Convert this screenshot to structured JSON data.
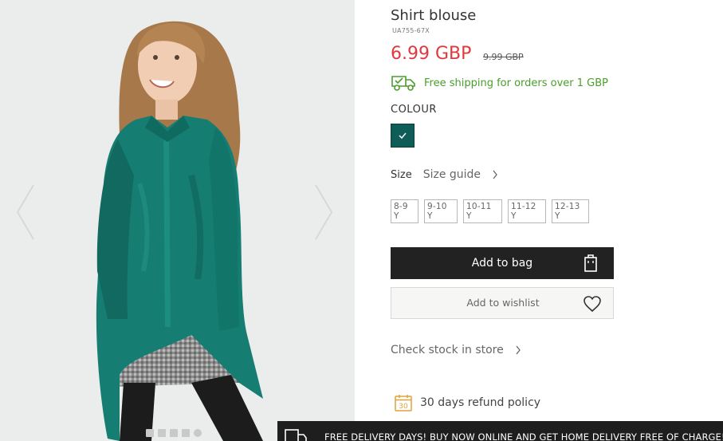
{
  "product": {
    "title": "Shirt blouse",
    "sku": "UA755-67X",
    "price": "6.99 GBP",
    "old_price": "9.99 GBP",
    "shipping_text": "Free shipping for orders over 1 GBP",
    "colour_label": "COLOUR",
    "selected_colour": "#0f5d57",
    "size_label": "Size",
    "size_guide_label": "Size guide",
    "sizes": [
      "8-9 Y",
      "9-10 Y",
      "10-11 Y",
      "11-12 Y",
      "12-13 Y"
    ],
    "add_to_bag_label": "Add to bag",
    "wishlist_label": "Add to wishlist",
    "check_stock_label": "Check stock in store",
    "refund_label": "30 days refund policy",
    "refund_icon_number": "30"
  },
  "gallery": {
    "dot_count": 5
  },
  "promo": {
    "text": "FREE DELIVERY DAYS! BUY NOW ONLINE AND GET HOME DELIVERY FREE OF CHARGE!"
  },
  "colors": {
    "price": "#e0393e",
    "shipping": "#4a9e2b",
    "refund_icon": "#e0a23a",
    "primary_button": "#222222",
    "promo_bar": "#1e1e1e"
  }
}
